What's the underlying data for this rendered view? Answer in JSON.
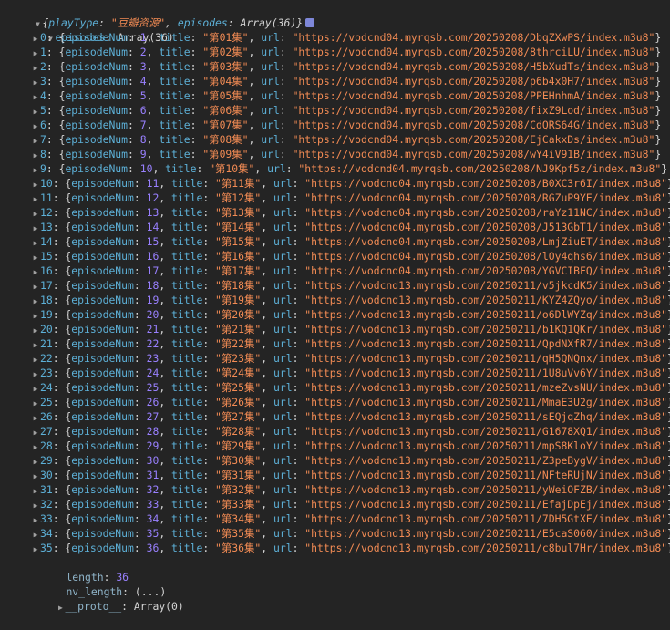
{
  "summary": {
    "key1": "playType",
    "val1": "\"豆瓣资源\"",
    "key2": "episodes",
    "val2": "Array(36)"
  },
  "episodes_header": {
    "key": "episodes",
    "value": "Array(36)"
  },
  "field_names": {
    "num": "episodeNum",
    "title": "title",
    "url": "url"
  },
  "episodes": [
    {
      "idx": "0",
      "num": "1",
      "title": "\"第01集\"",
      "url": "\"https://vodcnd04.myrqsb.com/20250208/DbqZXwPS/index.m3u8\""
    },
    {
      "idx": "1",
      "num": "2",
      "title": "\"第02集\"",
      "url": "\"https://vodcnd04.myrqsb.com/20250208/8thrciLU/index.m3u8\""
    },
    {
      "idx": "2",
      "num": "3",
      "title": "\"第03集\"",
      "url": "\"https://vodcnd04.myrqsb.com/20250208/H5bXudTs/index.m3u8\""
    },
    {
      "idx": "3",
      "num": "4",
      "title": "\"第04集\"",
      "url": "\"https://vodcnd04.myrqsb.com/20250208/p6b4x0H7/index.m3u8\""
    },
    {
      "idx": "4",
      "num": "5",
      "title": "\"第05集\"",
      "url": "\"https://vodcnd04.myrqsb.com/20250208/PPEHnhmA/index.m3u8\""
    },
    {
      "idx": "5",
      "num": "6",
      "title": "\"第06集\"",
      "url": "\"https://vodcnd04.myrqsb.com/20250208/fixZ9Lod/index.m3u8\""
    },
    {
      "idx": "6",
      "num": "7",
      "title": "\"第07集\"",
      "url": "\"https://vodcnd04.myrqsb.com/20250208/CdQRS64G/index.m3u8\""
    },
    {
      "idx": "7",
      "num": "8",
      "title": "\"第08集\"",
      "url": "\"https://vodcnd04.myrqsb.com/20250208/EjCakxDs/index.m3u8\""
    },
    {
      "idx": "8",
      "num": "9",
      "title": "\"第09集\"",
      "url": "\"https://vodcnd04.myrqsb.com/20250208/wY4iV91B/index.m3u8\""
    },
    {
      "idx": "9",
      "num": "10",
      "title": "\"第10集\"",
      "url": "\"https://vodcnd04.myrqsb.com/20250208/NJ9Kpf5z/index.m3u8\""
    },
    {
      "idx": "10",
      "num": "11",
      "title": "\"第11集\"",
      "url": "\"https://vodcnd04.myrqsb.com/20250208/B0XC3r6I/index.m3u8\""
    },
    {
      "idx": "11",
      "num": "12",
      "title": "\"第12集\"",
      "url": "\"https://vodcnd04.myrqsb.com/20250208/RGZuP9YE/index.m3u8\""
    },
    {
      "idx": "12",
      "num": "13",
      "title": "\"第13集\"",
      "url": "\"https://vodcnd04.myrqsb.com/20250208/raYz11NC/index.m3u8\""
    },
    {
      "idx": "13",
      "num": "14",
      "title": "\"第14集\"",
      "url": "\"https://vodcnd04.myrqsb.com/20250208/J513GbT1/index.m3u8\""
    },
    {
      "idx": "14",
      "num": "15",
      "title": "\"第15集\"",
      "url": "\"https://vodcnd04.myrqsb.com/20250208/LmjZiuET/index.m3u8\""
    },
    {
      "idx": "15",
      "num": "16",
      "title": "\"第16集\"",
      "url": "\"https://vodcnd04.myrqsb.com/20250208/lOy4qhs6/index.m3u8\""
    },
    {
      "idx": "16",
      "num": "17",
      "title": "\"第17集\"",
      "url": "\"https://vodcnd04.myrqsb.com/20250208/YGVCIBFQ/index.m3u8\""
    },
    {
      "idx": "17",
      "num": "18",
      "title": "\"第18集\"",
      "url": "\"https://vodcnd13.myrqsb.com/20250211/v5jkcdK5/index.m3u8\""
    },
    {
      "idx": "18",
      "num": "19",
      "title": "\"第19集\"",
      "url": "\"https://vodcnd13.myrqsb.com/20250211/KYZ4ZQyo/index.m3u8\""
    },
    {
      "idx": "19",
      "num": "20",
      "title": "\"第20集\"",
      "url": "\"https://vodcnd13.myrqsb.com/20250211/o6DlWYZq/index.m3u8\""
    },
    {
      "idx": "20",
      "num": "21",
      "title": "\"第21集\"",
      "url": "\"https://vodcnd13.myrqsb.com/20250211/b1KQ1QKr/index.m3u8\""
    },
    {
      "idx": "21",
      "num": "22",
      "title": "\"第22集\"",
      "url": "\"https://vodcnd13.myrqsb.com/20250211/QpdNXfR7/index.m3u8\""
    },
    {
      "idx": "22",
      "num": "23",
      "title": "\"第23集\"",
      "url": "\"https://vodcnd13.myrqsb.com/20250211/qH5QNQnx/index.m3u8\""
    },
    {
      "idx": "23",
      "num": "24",
      "title": "\"第24集\"",
      "url": "\"https://vodcnd13.myrqsb.com/20250211/1U8uVv6Y/index.m3u8\""
    },
    {
      "idx": "24",
      "num": "25",
      "title": "\"第25集\"",
      "url": "\"https://vodcnd13.myrqsb.com/20250211/mzeZvsNU/index.m3u8\""
    },
    {
      "idx": "25",
      "num": "26",
      "title": "\"第26集\"",
      "url": "\"https://vodcnd13.myrqsb.com/20250211/MmaE3U2g/index.m3u8\""
    },
    {
      "idx": "26",
      "num": "27",
      "title": "\"第27集\"",
      "url": "\"https://vodcnd13.myrqsb.com/20250211/sEQjqZhq/index.m3u8\""
    },
    {
      "idx": "27",
      "num": "28",
      "title": "\"第28集\"",
      "url": "\"https://vodcnd13.myrqsb.com/20250211/G1678XQ1/index.m3u8\""
    },
    {
      "idx": "28",
      "num": "29",
      "title": "\"第29集\"",
      "url": "\"https://vodcnd13.myrqsb.com/20250211/mpS8KloY/index.m3u8\""
    },
    {
      "idx": "29",
      "num": "30",
      "title": "\"第30集\"",
      "url": "\"https://vodcnd13.myrqsb.com/20250211/Z3peBygV/index.m3u8\""
    },
    {
      "idx": "30",
      "num": "31",
      "title": "\"第31集\"",
      "url": "\"https://vodcnd13.myrqsb.com/20250211/NFteRUjN/index.m3u8\""
    },
    {
      "idx": "31",
      "num": "32",
      "title": "\"第32集\"",
      "url": "\"https://vodcnd13.myrqsb.com/20250211/yWeiOFZB/index.m3u8\""
    },
    {
      "idx": "32",
      "num": "33",
      "title": "\"第33集\"",
      "url": "\"https://vodcnd13.myrqsb.com/20250211/EfajDpEj/index.m3u8\""
    },
    {
      "idx": "33",
      "num": "34",
      "title": "\"第34集\"",
      "url": "\"https://vodcnd13.myrqsb.com/20250211/7DH5GtXE/index.m3u8\""
    },
    {
      "idx": "34",
      "num": "35",
      "title": "\"第35集\"",
      "url": "\"https://vodcnd13.myrqsb.com/20250211/E5caS060/index.m3u8\""
    },
    {
      "idx": "35",
      "num": "36",
      "title": "\"第36集\"",
      "url": "\"https://vodcnd13.myrqsb.com/20250211/c8bul7Hr/index.m3u8\""
    }
  ],
  "length_row": {
    "key": "length",
    "value": "36"
  },
  "nvlength_row": {
    "key": "nv_length",
    "value": "(...)"
  },
  "proto_row": {
    "key": "__proto__",
    "value": "Array(0)"
  },
  "colors": {
    "background": "#242424",
    "key": "#5db0d7",
    "string": "#f28b54",
    "number": "#9980ff",
    "text": "#d4d4d4",
    "info_badge": "#7e87d8"
  },
  "icons": {
    "expanded": "triangle-down-icon",
    "collapsed": "triangle-right-icon",
    "info": "info-badge-icon"
  }
}
